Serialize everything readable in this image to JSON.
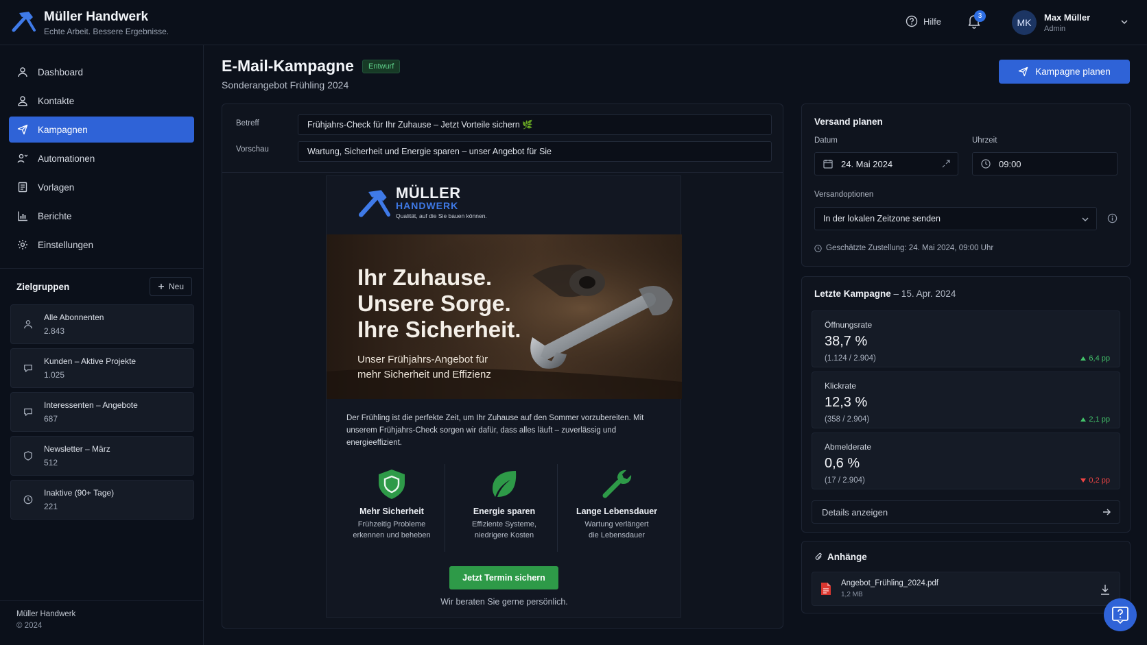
{
  "app": {
    "name": "Müller Handwerk",
    "tagline": "Echte Arbeit. Bessere Ergebnisse.",
    "help_label": "Hilfe",
    "notification_count": "3",
    "user": {
      "initials": "MK",
      "name": "Max Müller",
      "role": "Admin"
    }
  },
  "sidebar": {
    "nav": [
      {
        "label": "Dashboard",
        "icon": "user-icon"
      },
      {
        "label": "Kontakte",
        "icon": "contacts-icon"
      },
      {
        "label": "Kampagnen",
        "icon": "send-icon",
        "active": true
      },
      {
        "label": "Automationen",
        "icon": "automation-icon"
      },
      {
        "label": "Vorlagen",
        "icon": "template-icon"
      },
      {
        "label": "Berichte",
        "icon": "bar-chart-icon"
      },
      {
        "label": "Einstellungen",
        "icon": "gear-icon"
      }
    ],
    "groups_title": "Zielgruppen",
    "new_label": "Neu",
    "groups": [
      {
        "name": "Alle Abonnenten",
        "count": "2.843",
        "icon": "user-icon"
      },
      {
        "name": "Kunden – Aktive Projekte",
        "count": "1.025",
        "icon": "chat-icon"
      },
      {
        "name": "Interessenten – Angebote",
        "count": "687",
        "icon": "chat-icon"
      },
      {
        "name": "Newsletter – März",
        "count": "512",
        "icon": "shield-icon"
      },
      {
        "name": "Inaktive (90+ Tage)",
        "count": "221",
        "icon": "clock-icon"
      }
    ],
    "footer_name": "Müller Handwerk",
    "footer_copy": "© 2024"
  },
  "main": {
    "title": "E-Mail-Kampagne",
    "status": "Entwurf",
    "subtitle": "Sonderangebot Frühling 2024",
    "plan_button": "Kampagne planen",
    "subject_label": "Betreff",
    "subject_value": "Frühjahrs-Check für Ihr Zuhause – Jetzt Vorteile sichern 🌿",
    "preview_label": "Vorschau",
    "preview_value": "Wartung, Sicherheit und Energie sparen – unser Angebot für Sie"
  },
  "email": {
    "logo_line1": "MÜLLER",
    "logo_line2": "HANDWERK",
    "logo_tagline": "Qualität, auf die Sie bauen können.",
    "hero_line1": "Ihr Zuhause.",
    "hero_line2": "Unsere Sorge.",
    "hero_line3": "Ihre Sicherheit.",
    "hero_sub1": "Unser Frühjahrs-Angebot für",
    "hero_sub2": "mehr Sicherheit und Effizienz",
    "body": "Der Frühling ist die perfekte Zeit, um Ihr Zuhause auf den Sommer vorzubereiten. Mit unserem Frühjahrs-Check sorgen wir dafür, dass alles läuft – zuverlässig und energieeffizient.",
    "features": [
      {
        "title": "Mehr Sicherheit",
        "desc1": "Frühzeitig Probleme",
        "desc2": "erkennen und beheben",
        "icon": "shield-icon"
      },
      {
        "title": "Energie sparen",
        "desc1": "Effiziente Systeme,",
        "desc2": "niedrigere Kosten",
        "icon": "leaf-icon"
      },
      {
        "title": "Lange Lebensdauer",
        "desc1": "Wartung verlängert",
        "desc2": "die Lebensdauer",
        "icon": "wrench-icon"
      }
    ],
    "cta": "Jetzt Termin sichern",
    "cta_sub": "Wir beraten Sie gerne persönlich."
  },
  "schedule": {
    "title": "Versand planen",
    "date_label": "Datum",
    "date_value": "24. Mai 2024",
    "time_label": "Uhrzeit",
    "time_value": "09:00",
    "options_label": "Versandoptionen",
    "option_value": "In der lokalen Zeitzone senden",
    "estimate": "Geschätzte Zustellung: 24. Mai 2024, 09:00 Uhr"
  },
  "last_campaign": {
    "title": "Letzte Kampagne",
    "date": "– 15. Apr. 2024",
    "stats": [
      {
        "name": "Öffnungsrate",
        "value": "38,7 %",
        "sub": "(1.124 / 2.904)",
        "delta": "6,4 pp",
        "trend": "up"
      },
      {
        "name": "Klickrate",
        "value": "12,3 %",
        "sub": "(358 / 2.904)",
        "delta": "2,1 pp",
        "trend": "up"
      },
      {
        "name": "Abmelderate",
        "value": "0,6 %",
        "sub": "(17 / 2.904)",
        "delta": "0,2 pp",
        "trend": "down"
      }
    ],
    "details_label": "Details anzeigen"
  },
  "attachments": {
    "title": "Anhänge",
    "file_name": "Angebot_Frühling_2024.pdf",
    "file_size": "1,2 MB"
  },
  "colors": {
    "accent": "#2f63d7",
    "success": "#2e9a48",
    "danger": "#ef4444",
    "background": "#0c111b"
  }
}
